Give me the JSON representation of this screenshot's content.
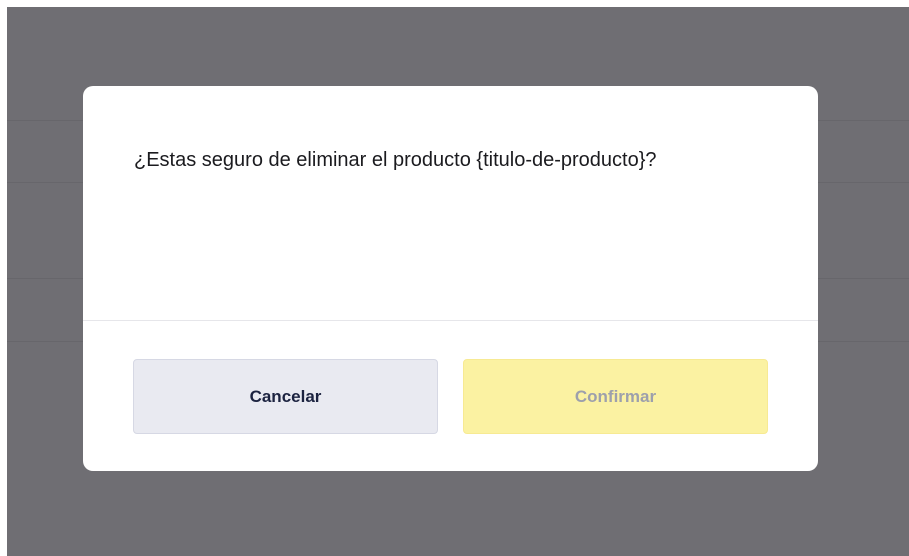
{
  "dialog": {
    "message": "¿Estas seguro de eliminar el producto {titulo-de-producto}?",
    "cancel_label": "Cancelar",
    "confirm_label": "Confirmar"
  },
  "colors": {
    "overlay": "#6f6e73",
    "modal_background": "#ffffff",
    "cancel_background": "#e9eaf1",
    "cancel_text": "#1c2340",
    "confirm_background": "#fbf2a2",
    "confirm_text": "#9da0ac"
  }
}
